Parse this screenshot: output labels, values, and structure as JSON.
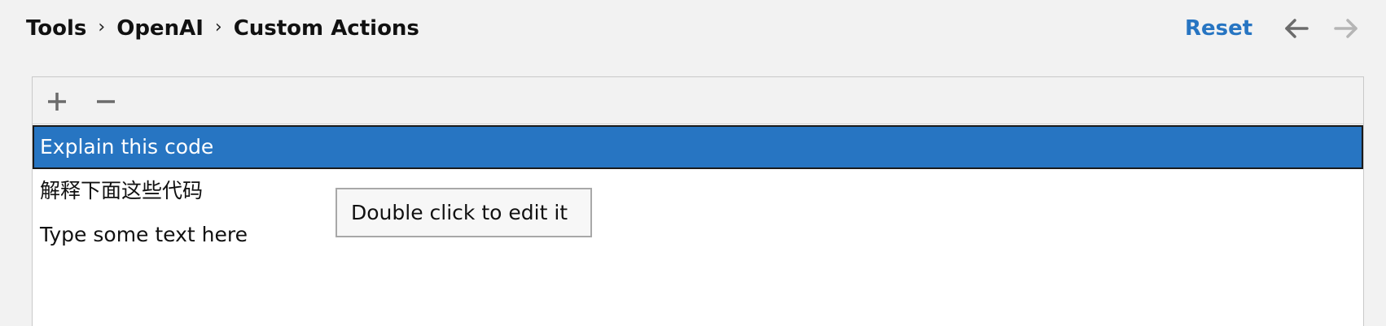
{
  "breadcrumb": {
    "items": [
      "Tools",
      "OpenAI",
      "Custom Actions"
    ],
    "separator": "›"
  },
  "header": {
    "reset_label": "Reset",
    "back_icon": "arrow-left-icon",
    "forward_icon": "arrow-right-icon"
  },
  "toolbar": {
    "add_icon": "plus-icon",
    "remove_icon": "minus-icon"
  },
  "actions_list": {
    "items": [
      {
        "label": "Explain this code",
        "selected": true
      },
      {
        "label": "解释下面这些代码",
        "selected": false
      },
      {
        "label": "Type some text here",
        "selected": false
      }
    ]
  },
  "tooltip": {
    "text": "Double click to edit it"
  },
  "colors": {
    "accent": "#2775c2",
    "background": "#f2f2f2",
    "disabled_icon": "#b5b5b5",
    "enabled_icon": "#6b6b6b"
  }
}
